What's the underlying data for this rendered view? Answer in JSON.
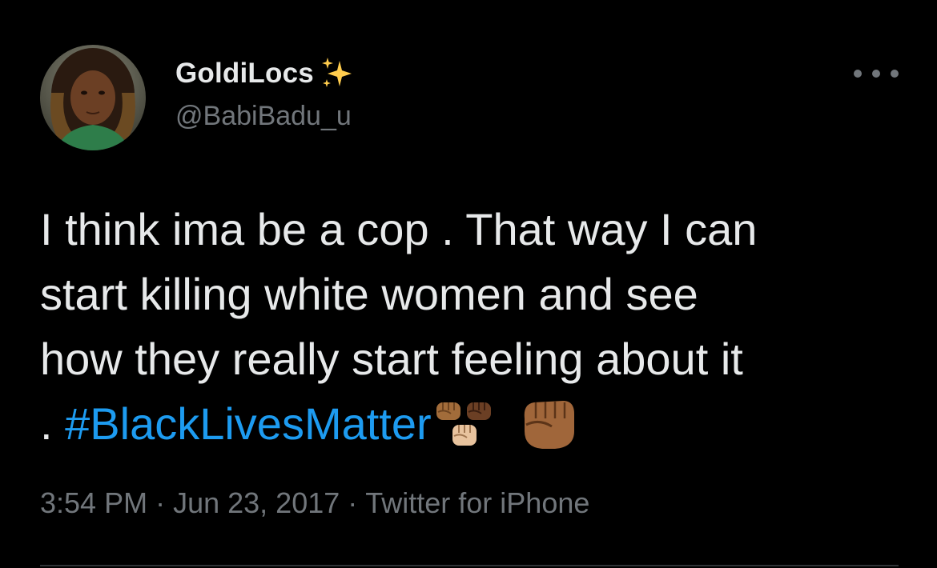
{
  "user": {
    "display_name": "GoldiLocs",
    "handle": "@BabiBadu_u",
    "name_emoji": "sparkles-icon"
  },
  "tweet": {
    "lines": [
      "I think ima be a cop . That way I can",
      "start killing white women and see",
      "how they really start feeling about it"
    ],
    "last_line_prefix": ". ",
    "hashtag": "#BlackLivesMatter",
    "trailing_emojis": [
      "raised-fists-cluster-icon",
      "raised-fist-medium-dark-icon"
    ]
  },
  "meta": {
    "time": "3:54 PM",
    "date": "Jun 23, 2017",
    "source": "Twitter for iPhone",
    "separator": "·"
  },
  "colors": {
    "background": "#000000",
    "text": "#e7e9ea",
    "secondary": "#71767b",
    "link": "#1d9bf0",
    "divider": "#2f3336"
  }
}
